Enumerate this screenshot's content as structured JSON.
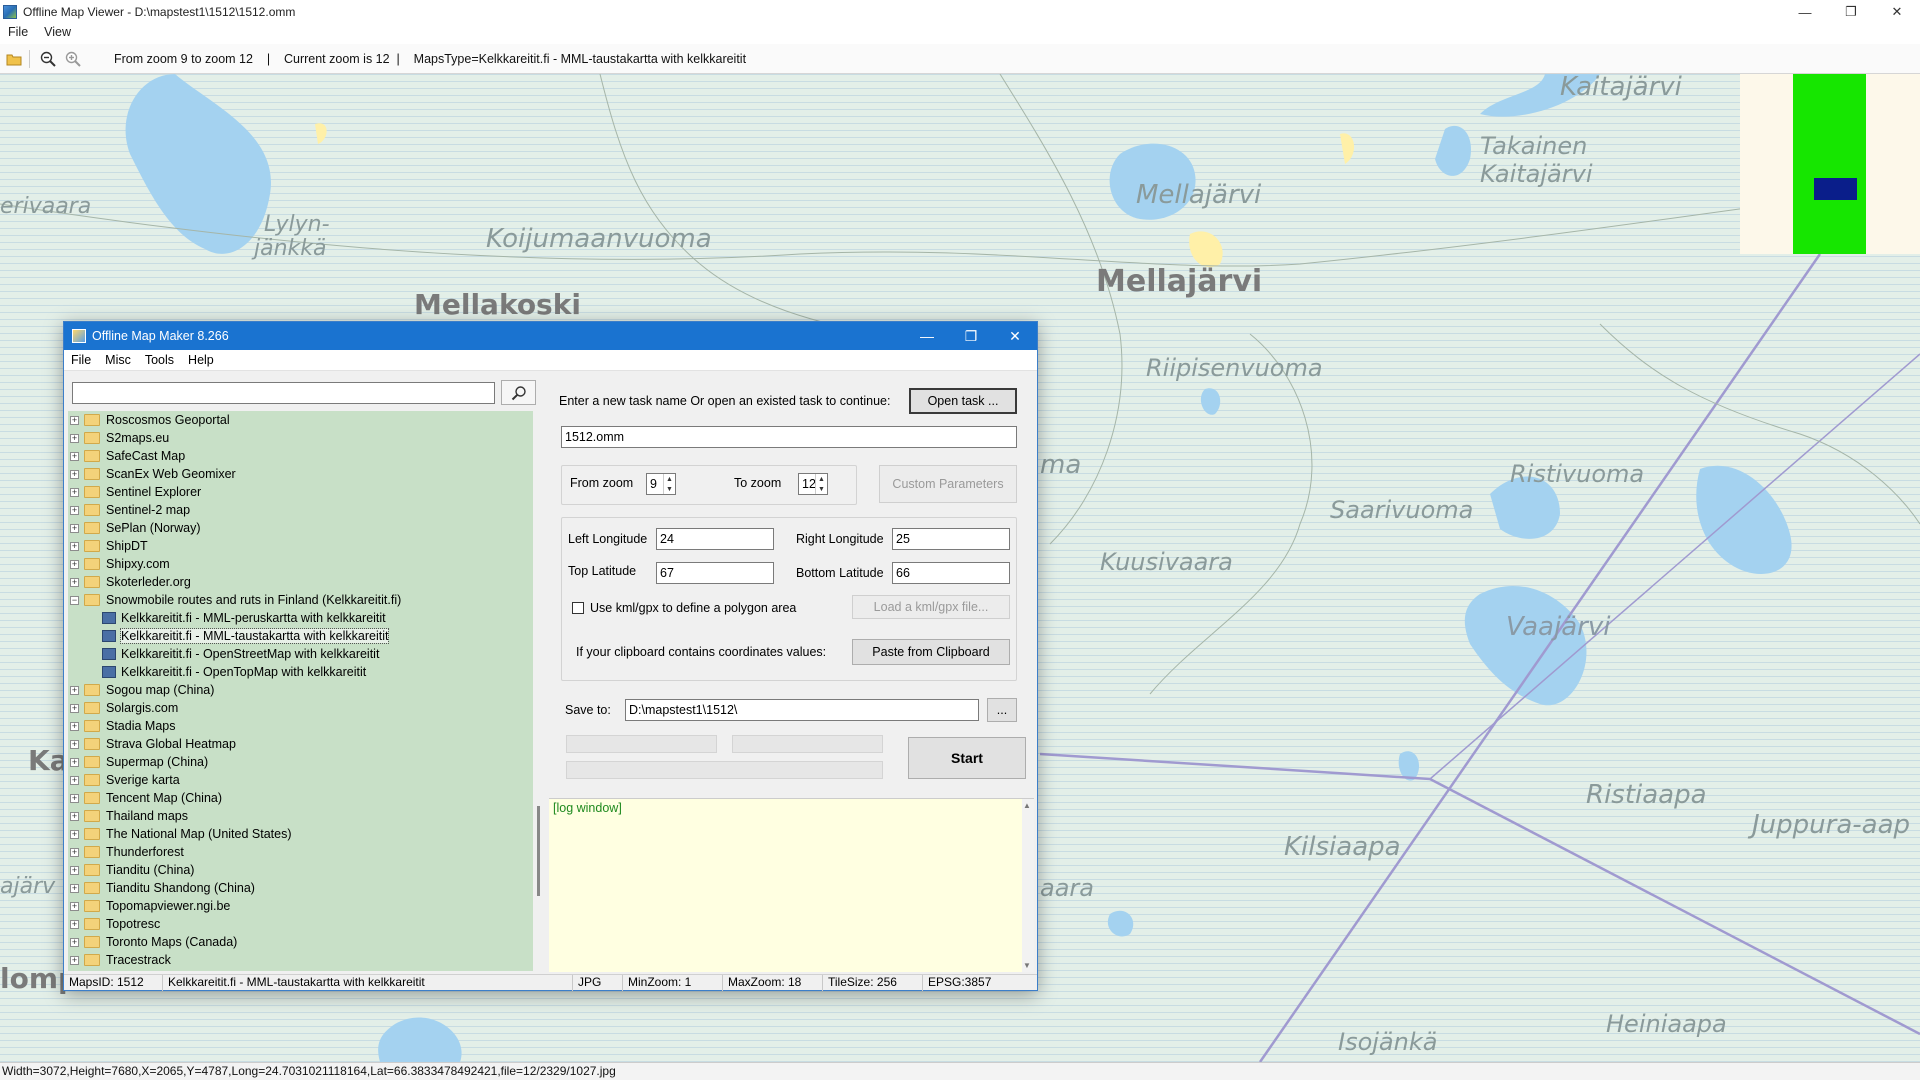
{
  "viewer": {
    "title": "Offline Map Viewer - D:\\mapstest1\\1512\\1512.omm",
    "menu": [
      "File",
      "View"
    ],
    "toolbar_info": "From zoom 9 to zoom 12    |    Current zoom is 12  |    MapsType=Kelkkareitit.fi - MML-taustakartta with kelkkareitit",
    "status": "Width=3072,Height=7680,X=2065,Y=4787,Long=24.7031021118164,Lat=66.3833478492421,file=12/2329/1027.jpg",
    "controls": [
      "—",
      "❐",
      "✕"
    ]
  },
  "map": {
    "places": [
      {
        "name": "Kaitajärvi"
      },
      {
        "name": "Takainen"
      },
      {
        "name": "Kaitajärvi"
      },
      {
        "name": "Mellajärvi"
      },
      {
        "name": "Mellajärvi"
      },
      {
        "name": "erivaara"
      },
      {
        "name": "Lylyn-"
      },
      {
        "name": "jänkkä"
      },
      {
        "name": "Koijumaanvuoma"
      },
      {
        "name": "Mellakoski"
      },
      {
        "name": "Riipisenvuoma"
      },
      {
        "name": "Ristivuoma"
      },
      {
        "name": "Saarivuoma"
      },
      {
        "name": "Kuusivaara"
      },
      {
        "name": "Vaajärvi"
      },
      {
        "name": "Ristiaapa"
      },
      {
        "name": "Juppura-aap"
      },
      {
        "name": "Kilsiaapa"
      },
      {
        "name": "Heiniaapa"
      },
      {
        "name": "Isojänkä"
      },
      {
        "name": "Ka"
      },
      {
        "name": "ajärv"
      },
      {
        "name": "lomp"
      },
      {
        "name": "ma"
      },
      {
        "name": "aara"
      }
    ]
  },
  "dialog": {
    "title": "Offline Map Maker 8.266",
    "menu": [
      "File",
      "Misc",
      "Tools",
      "Help"
    ],
    "search_value": "",
    "tree": [
      {
        "label": "Roscosmos Geoportal",
        "type": "folder"
      },
      {
        "label": "S2maps.eu",
        "type": "folder"
      },
      {
        "label": "SafeCast Map",
        "type": "folder"
      },
      {
        "label": "ScanEx Web Geomixer",
        "type": "folder"
      },
      {
        "label": "Sentinel Explorer",
        "type": "folder"
      },
      {
        "label": "Sentinel-2 map",
        "type": "folder"
      },
      {
        "label": "SePlan (Norway)",
        "type": "folder"
      },
      {
        "label": "ShipDT",
        "type": "folder"
      },
      {
        "label": "Shipxy.com",
        "type": "folder"
      },
      {
        "label": "Skoterleder.org",
        "type": "folder"
      },
      {
        "label": "Snowmobile routes and ruts in Finland (Kelkkareitit.fi)",
        "type": "open-folder"
      },
      {
        "label": "Kelkkareitit.fi - MML-peruskartta with kelkkareitit",
        "type": "map"
      },
      {
        "label": "Kelkkareitit.fi - MML-taustakartta with kelkkareitit",
        "type": "map",
        "selected": true
      },
      {
        "label": "Kelkkareitit.fi - OpenStreetMap with kelkkareitit",
        "type": "map"
      },
      {
        "label": "Kelkkareitit.fi - OpenTopMap with kelkkareitit",
        "type": "map"
      },
      {
        "label": "Sogou map (China)",
        "type": "folder"
      },
      {
        "label": "Solargis.com",
        "type": "folder"
      },
      {
        "label": "Stadia Maps",
        "type": "folder"
      },
      {
        "label": "Strava Global Heatmap",
        "type": "folder"
      },
      {
        "label": "Supermap (China)",
        "type": "folder"
      },
      {
        "label": "Sverige karta",
        "type": "folder"
      },
      {
        "label": "Tencent Map (China)",
        "type": "folder"
      },
      {
        "label": "Thailand maps",
        "type": "folder"
      },
      {
        "label": "The National Map (United States)",
        "type": "folder"
      },
      {
        "label": "Thunderforest",
        "type": "folder"
      },
      {
        "label": "Tianditu (China)",
        "type": "folder"
      },
      {
        "label": "Tianditu Shandong (China)",
        "type": "folder"
      },
      {
        "label": "Topomapviewer.ngi.be",
        "type": "folder"
      },
      {
        "label": "Topotresc",
        "type": "folder"
      },
      {
        "label": "Toronto Maps (Canada)",
        "type": "folder"
      },
      {
        "label": "Tracestrack",
        "type": "folder"
      }
    ],
    "task_prompt": "Enter a new task name Or open an existed task to continue:",
    "open_task_button": "Open task ...",
    "task_name": "1512.omm",
    "from_zoom_label": "From zoom",
    "from_zoom": "9",
    "to_zoom_label": "To zoom",
    "to_zoom": "12",
    "custom_params_button": "Custom Parameters",
    "left_lon_label": "Left Longitude",
    "left_lon": "24",
    "right_lon_label": "Right Longitude",
    "right_lon": "25",
    "top_lat_label": "Top Latitude",
    "top_lat": "67",
    "bottom_lat_label": "Bottom Latitude",
    "bottom_lat": "66",
    "kml_checkbox_label": "Use kml/gpx to define a polygon area",
    "kml_checked": false,
    "load_kml_button": "Load a kml/gpx file...",
    "clipboard_label": "If your clipboard contains coordinates values:",
    "paste_button": "Paste from Clipboard",
    "save_to_label": "Save to:",
    "save_to": "D:\\mapstest1\\1512\\",
    "browse_button": "...",
    "start_button": "Start",
    "log_text": "[log window]",
    "status": {
      "maps_id": "MapsID: 1512",
      "maps_name": "Kelkkareitit.fi - MML-taustakartta with kelkkareitit",
      "format": "JPG",
      "min_zoom": "MinZoom: 1",
      "max_zoom": "MaxZoom: 18",
      "tile_size": "TileSize: 256",
      "epsg": "EPSG:3857"
    }
  },
  "colors": {
    "map_bg": "#e3efe8",
    "water": "#a4d2f0",
    "titlebar_blue": "#1a73d0",
    "tree_bg": "#c8e0c7",
    "log_bg": "#ffffe1",
    "overview_green": "#16e600",
    "overview_rect": "#0a1e8a"
  }
}
